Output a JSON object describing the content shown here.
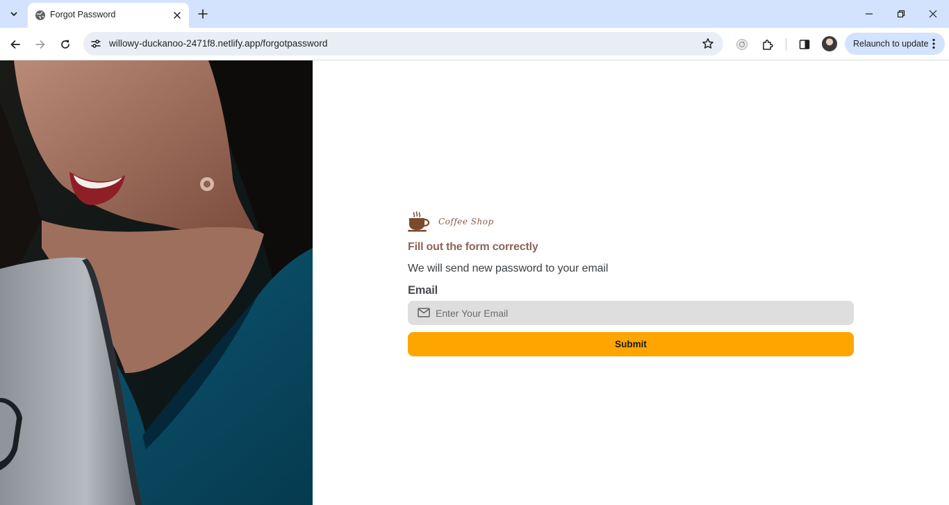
{
  "browser": {
    "tab_title": "Forgot Password",
    "url": "willowy-duckanoo-2471f8.netlify.app/forgotpassword",
    "relaunch_label": "Relaunch to update"
  },
  "brand": {
    "name": "Coffee Shop",
    "logo_icon": "coffee-cup-icon"
  },
  "form": {
    "heading": "Fill out the form correctly",
    "subheading": "We will send new password to your email",
    "email_label": "Email",
    "email_placeholder": "Enter Your Email",
    "email_value": "",
    "submit_label": "Submit"
  },
  "colors": {
    "accent": "#ffa500",
    "heading": "#8a6658",
    "input_bg": "#dedede",
    "chrome_tabstrip": "#d3e3fd"
  }
}
